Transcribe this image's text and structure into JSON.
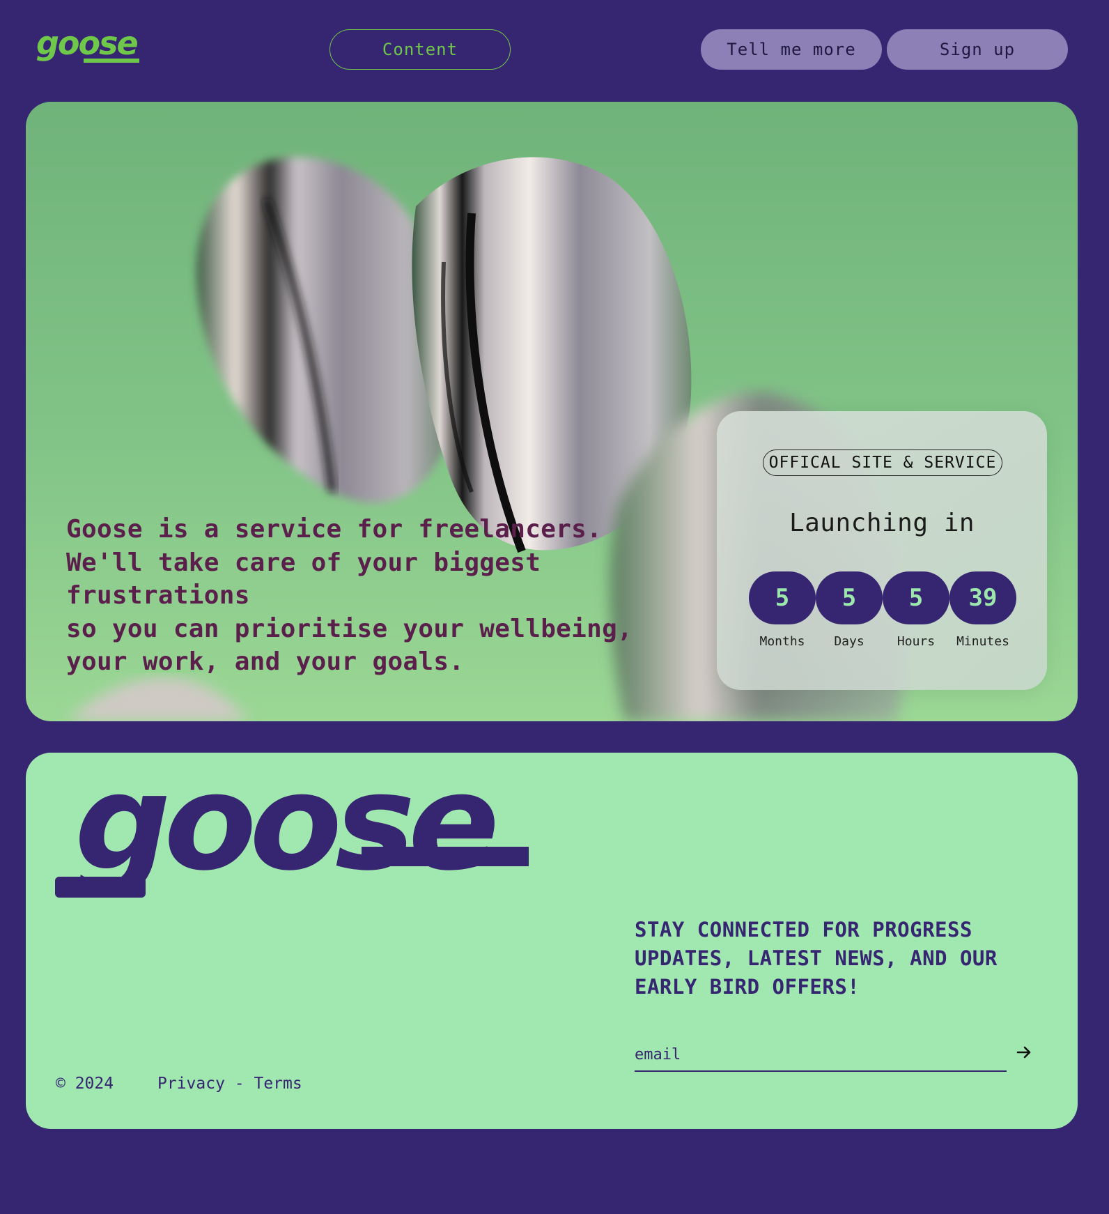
{
  "header": {
    "logo_text": "goose",
    "nav": {
      "content_label": "Content",
      "more_label": "Tell me more",
      "signup_label": "Sign up"
    }
  },
  "hero": {
    "description_lines": [
      "Goose is a service for freelancers.",
      "We'll take care of your biggest",
      "frustrations",
      "so you can prioritise your wellbeing,",
      "your work, and your goals."
    ],
    "countdown": {
      "badge": "OFFICAL SITE & SERVICE",
      "title": "Launching in",
      "units": [
        {
          "value": "5",
          "label": "Months"
        },
        {
          "value": "5",
          "label": "Days"
        },
        {
          "value": "5",
          "label": "Hours"
        },
        {
          "value": "39",
          "label": "Minutes"
        }
      ]
    }
  },
  "footer": {
    "logo_text": "goose",
    "newsletter_text": "STAY CONNECTED FOR PROGRESS UPDATES, LATEST NEWS, AND OUR EARLY BIRD OFFERS!",
    "email_placeholder": "email",
    "copyright": "© 2024",
    "privacy_label": "Privacy",
    "legal_separator": " - ",
    "terms_label": "Terms"
  },
  "colors": {
    "page_background": "#362570",
    "brand_green": "#6fc84a",
    "footer_card": "#a0e8b0",
    "nav_pill": "#8d80b6",
    "hero_text": "#5b1f4c",
    "countdown_circle": "#362570"
  },
  "icons": {
    "submit": "arrow-right-icon"
  }
}
